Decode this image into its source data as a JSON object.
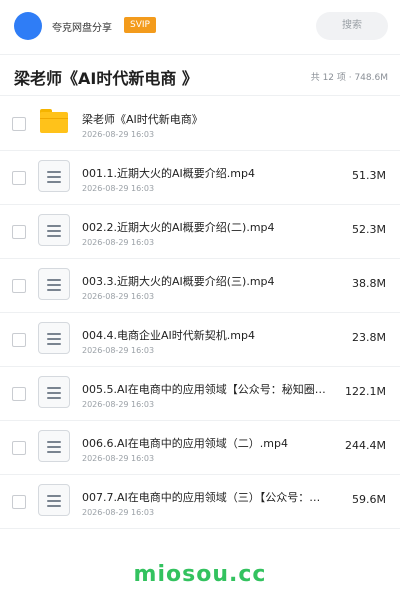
{
  "header": {
    "user_name": "夸克网盘分享",
    "badge": "SVIP",
    "search_placeholder": "搜索"
  },
  "folder": {
    "title": "梁老师《AI时代新电商 》",
    "meta": "共 12 项 · 748.6M"
  },
  "items": [
    {
      "type": "folder",
      "name": "梁老师《AI时代新电商》",
      "date": "2026-08-29 16:03",
      "size": ""
    },
    {
      "type": "file",
      "name": "001.1.近期大火的AI概要介绍.mp4",
      "date": "2026-08-29 16:03",
      "size": "51.3M"
    },
    {
      "type": "file",
      "name": "002.2.近期大火的AI概要介绍(二).mp4",
      "date": "2026-08-29 16:03",
      "size": "52.3M"
    },
    {
      "type": "file",
      "name": "003.3.近期大火的AI概要介绍(三).mp4",
      "date": "2026-08-29 16:03",
      "size": "38.8M"
    },
    {
      "type": "file",
      "name": "004.4.电商企业AI时代新契机.mp4",
      "date": "2026-08-29 16:03",
      "size": "23.8M"
    },
    {
      "type": "file",
      "name": "005.5.AI在电商中的应用领域【公众号：秘知圈…",
      "date": "2026-08-29 16:03",
      "size": "122.1M"
    },
    {
      "type": "file",
      "name": "006.6.AI在电商中的应用领域（二）.mp4",
      "date": "2026-08-29 16:03",
      "size": "244.4M"
    },
    {
      "type": "file",
      "name": "007.7.AI在电商中的应用领域（三）【公众号：…",
      "date": "2026-08-29 16:03",
      "size": "59.6M"
    }
  ],
  "footer": {
    "watermark": "miosou.cc"
  },
  "colors": {
    "accent_blue": "#2f7df6",
    "svip_orange": "#f39b1c",
    "folder_yellow": "#ffc21a",
    "watermark_green": "#33c25f"
  }
}
